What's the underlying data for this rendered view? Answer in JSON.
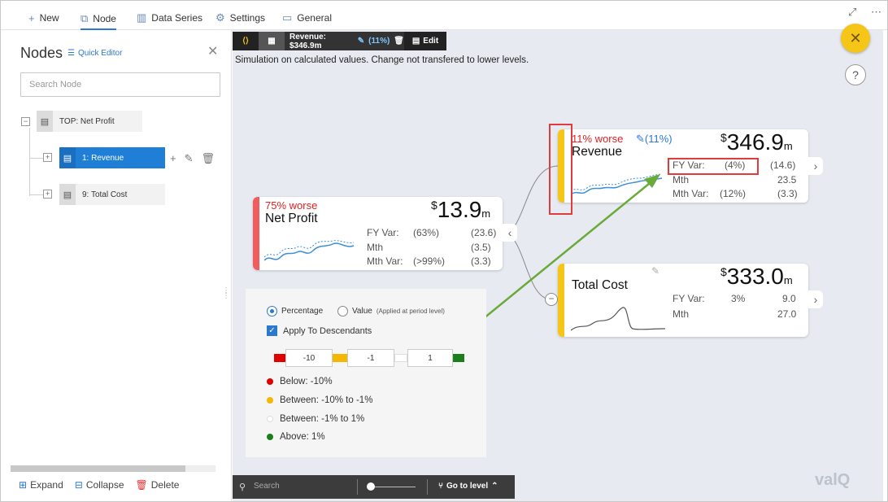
{
  "tabs": [
    {
      "label": "New",
      "icon": "plus-icon"
    },
    {
      "label": "Node",
      "icon": "node-tree-icon"
    },
    {
      "label": "Data Series",
      "icon": "bar-chart-icon"
    },
    {
      "label": "Settings",
      "icon": "gear-icon"
    },
    {
      "label": "General",
      "icon": "monitor-icon"
    }
  ],
  "left": {
    "title": "Nodes",
    "quick_editor": "Quick Editor",
    "search_placeholder": "Search Node",
    "tree": [
      {
        "label": "TOP: Net Profit"
      },
      {
        "label": "1: Revenue",
        "selected": true
      },
      {
        "label": "9: Total Cost"
      }
    ],
    "footer": {
      "expand": "Expand",
      "collapse": "Collapse",
      "delete": "Delete"
    }
  },
  "toolbar": {
    "summary": "Revenue: $346.9m",
    "sim_pct": "(11%)",
    "edit": "Edit"
  },
  "sim_note": "Simulation on calculated values. Change not transfered to lower levels.",
  "cards": {
    "net_profit": {
      "status": "75% worse",
      "name": "Net Profit",
      "currency": "$",
      "value": "13.9",
      "unit": "m",
      "bar_color": "#f25c5c",
      "rows": [
        {
          "label": "FY Var:",
          "pct": "(63%)",
          "val": "(23.6)"
        },
        {
          "label": "Mth",
          "pct": "",
          "val": "(3.5)"
        },
        {
          "label": "Mth Var:",
          "pct": "(>99%)",
          "val": "(3.3)"
        }
      ]
    },
    "revenue": {
      "status": "11% worse",
      "sim": "(11%)",
      "name": "Revenue",
      "currency": "$",
      "value": "346.9",
      "unit": "m",
      "bar_color": "#f5c518",
      "rows": [
        {
          "label": "FY Var:",
          "pct": "(4%)",
          "val": "(14.6)"
        },
        {
          "label": "Mth",
          "pct": "",
          "val": "23.5"
        },
        {
          "label": "Mth Var:",
          "pct": "(12%)",
          "val": "(3.3)"
        }
      ]
    },
    "total_cost": {
      "name": "Total Cost",
      "currency": "$",
      "value": "333.0",
      "unit": "m",
      "bar_color": "#f5c518",
      "rows": [
        {
          "label": "FY Var:",
          "pct": "3%",
          "val": "9.0"
        },
        {
          "label": "Mth",
          "pct": "",
          "val": "27.0"
        }
      ]
    }
  },
  "legend": {
    "percentage": "Percentage",
    "value": "Value",
    "value_note": "(Applied at period level)",
    "apply": "Apply To Descendants",
    "thresholds": [
      "-10",
      "-1",
      "1"
    ],
    "items": [
      {
        "label": "Below: -10%",
        "color": "#e00000"
      },
      {
        "label": "Between: -10% to -1%",
        "color": "#f5b800"
      },
      {
        "label": "Between: -1% to 1%",
        "color": "#ffffff"
      },
      {
        "label": "Above: 1%",
        "color": "#1a7f1a"
      }
    ]
  },
  "bottom": {
    "search": "Search",
    "goto": "Go to level"
  },
  "brand": "valQ",
  "colors": {
    "accent": "#2b78d0",
    "arrow": "#6aaa3a",
    "highlight": "#e03c3c"
  }
}
